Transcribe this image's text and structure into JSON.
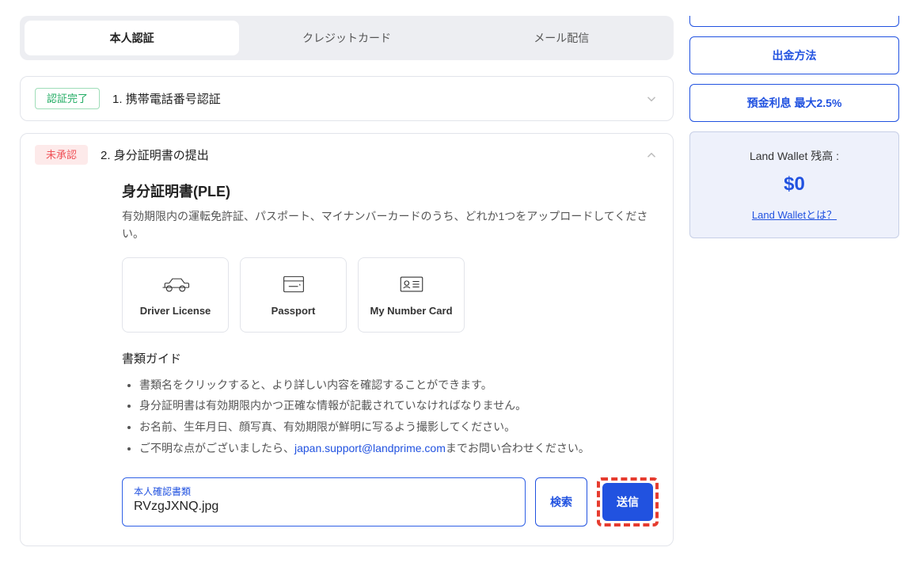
{
  "tabs": {
    "identity": "本人認証",
    "credit": "クレジットカード",
    "mail": "メール配信"
  },
  "step1": {
    "badge": "認証完了",
    "title": "1. 携帯電話番号認証"
  },
  "step2": {
    "badge": "未承認",
    "title": "2. 身分証明書の提出",
    "heading": "身分証明書(PLE)",
    "desc": "有効期限内の運転免許証、パスポート、マイナンバーカードのうち、どれか1つをアップロードしてください。",
    "cards": {
      "driver": "Driver License",
      "passport": "Passport",
      "mynumber": "My Number Card"
    },
    "guide_heading": "書類ガイド",
    "guide": {
      "g1": "書類名をクリックすると、より詳しい内容を確認することができます。",
      "g2": "身分証明書は有効期限内かつ正確な情報が記載されていなければなりません。",
      "g3": "お名前、生年月日、顔写真、有効期限が鮮明に写るよう撮影してください。",
      "g4_prefix": "ご不明な点がございましたら、",
      "g4_email": "japan.support@landprime.com",
      "g4_suffix": "までお問い合わせください。"
    },
    "file": {
      "label": "本人確認書類",
      "name": "RVzgJXNQ.jpg",
      "search_btn": "検索",
      "send_btn": "送信"
    }
  },
  "sidebar": {
    "withdraw": "出金方法",
    "interest": "預金利息 最大2.5%",
    "wallet_title": "Land Wallet 残高 :",
    "wallet_amount": "$0",
    "wallet_link": "Land Walletとは？"
  }
}
